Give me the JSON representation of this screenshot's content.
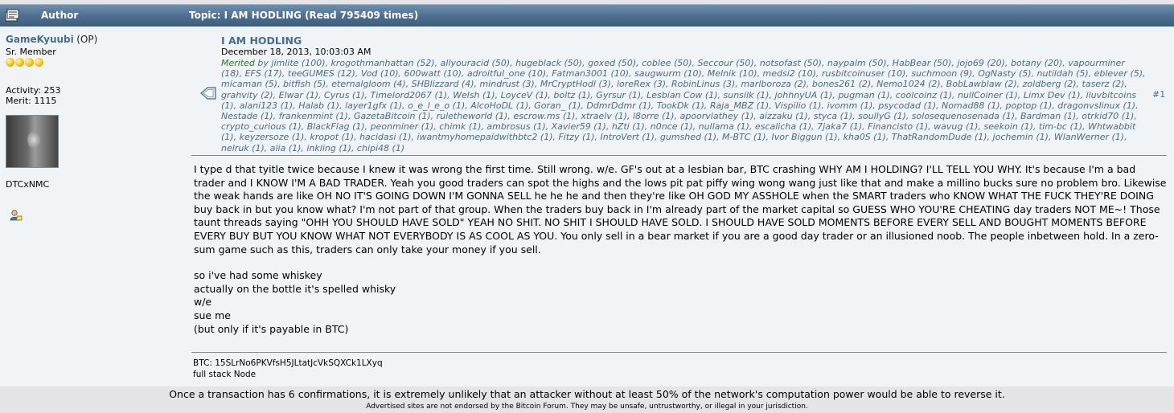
{
  "header": {
    "author_label": "Author",
    "topic_label": "Topic: I AM HODLING  (Read 795409 times)"
  },
  "poster": {
    "name": "GameKyuubi",
    "op_tag": "(OP)",
    "rank": "Sr. Member",
    "star_count": 4,
    "activity": "Activity: 253",
    "merit": "Merit: 1115",
    "personal_text": "DTCxNMC"
  },
  "post": {
    "subject": "I AM HODLING",
    "date": "December 18, 2013, 10:03:03 AM",
    "number": "#1",
    "merited_label": "Merited",
    "merited_text": " by jimlite (100), krogothmanhattan (52), allyouracid (50), hugeblack (50), goxed (50), coblee (50), Seccour (50), notsofast (50), naypalm (50), HabBear (50), jojo69 (20), botany (20), vapourminer (18), EFS (17), teeGUMES (12), Vod (10), 600watt (10), adroitful_one (10), Fatman3001 (10), saugwurm (10), Melnik (10), medsi2 (10), rusbitcoinuser (10), suchmoon (9), OgNasty (5), nutildah (5), eblever (5), micaman (5), bitfish (5), eternalgloom (4), SHBlizzard (4), mindrust (3), MrCryptHodl (3), loreRex (3), RobinLinus (3), marlboroza (2), bones261 (2), Nemo1024 (2), BobLawblaw (2), zoldberg (2), taserz (2), grahvity (2), Elwar (1), Cyrus (1), Timelord2067 (1), Welsh (1), LoyceV (1), boltz (1), Gyrsur (1), Lesbian Cow (1), sunsilk (1), johhnyUA (1), pugman (1), coolcoinz (1), nullCoiner (1), Limx Dev (1), iluvbitcoins (1), alani123 (1), Halab (1), layer1gfx (1), o_e_l_e_o (1), AlcoHoDL (1), Goran_ (1), DdmrDdmr (1), TookDk (1), Raja_MBZ (1), Vispilio (1), ivomm (1), psycodad (1), Nomad88 (1), poptop (1), dragonvslinux (1), Nestade (1), frankenmint (1), GazetaBitcoin (1), ruletheworld (1), escrow.ms (1), xtraelv (1), l8orre (1), apoorvlathey (1), aizzaku (1), styca (1), soullyG (1), solosequenosenada (1), Bardman (1), otrkid70 (1), crypto_curious (1), BlackFlag (1), peonminer (1), chimk (1), ambrosus (1), Xavier59 (1), hZti (1), n0nce (1), nullama (1), escalicha (1), 7jaka7 (1), Financisto (1), wavug (1), seekoin (1), tim-bc (1), Whtwabbit (1), keyzersoze (1), kropot (1), hacidasi (1), iwantmyhomepaidwithbtc2 (1), Fitzy (1), IntroVert (1), gumshed (1), M-BTC (1), Ivor Biggun (1), kha0S (1), ThatRandomDude (1), jochemin (1), WlanWerner (1), nelruk (1), alia (1), inkling (1), chipi48 (1)",
    "paragraph1": "I type d that tyitle twice because I knew it was wrong the first time.  Still wrong.  w/e.  GF's out at a lesbian bar, BTC crashing WHY AM I HOLDING? I'LL TELL YOU WHY.  It's because I'm a bad trader and I KNOW I'M A BAD TRADER.  Yeah you good traders can spot the highs and the lows pit pat piffy wing wong wang just like that and make a millino bucks sure no problem bro.  Likewise the weak hands are like OH NO IT'S GOING DOWN I'M GONNA SELL he he he and then they're like OH GOD MY ASSHOLE when the SMART traders who KNOW WHAT THE FUCK THEY'RE DOING buy back in but you know what?  I'm not part of that group.  When the traders buy back in I'm already part of the market capital so GUESS WHO YOU'RE CHEATING day traders NOT ME~!  Those taunt threads saying \"OHH YOU SHOULD HAVE SOLD\" YEAH NO SHIT.  NO SHIT I SHOULD HAVE SOLD.  I SHOULD HAVE SOLD MOMENTS BEFORE EVERY SELL AND BOUGHT MOMENTS BEFORE EVERY BUY BUT YOU KNOW WHAT NOT EVERYBODY IS AS COOL AS YOU.  You only sell in a bear market if you are a good day trader or an illusioned noob.  The people inbetween hold.  In a zero-sum game such as this, traders can only take your money if you sell.",
    "line1": "so i've had some whiskey",
    "line2": "actually on the bottle it's spelled whisky",
    "line3": "w/e",
    "line4": "sue me",
    "line5": "(but only if it's payable in BTC)"
  },
  "signature": {
    "line1": "BTC: 15SLrNo6PKVfsH5JLtatJcVkSQXCk1LXyq",
    "line2": "full stack Node"
  },
  "footer": {
    "line1": "Once a transaction has 6 confirmations, it is extremely unlikely that an attacker without at least 50% of the network's computation power would be able to reverse it.",
    "line2": "Advertised sites are not endorsed by the Bitcoin Forum. They may be unsafe, untrustworthy, or illegal in your jurisdiction."
  },
  "colors": {
    "header_bg": "#4d6d8f",
    "link": "#476c8e",
    "merited_label": "#2a7a2a",
    "post_bg": "#f0f4f7"
  },
  "icons": [
    "topic-icon",
    "star-icon",
    "avatar",
    "pm-icon",
    "post-subject-icon"
  ]
}
